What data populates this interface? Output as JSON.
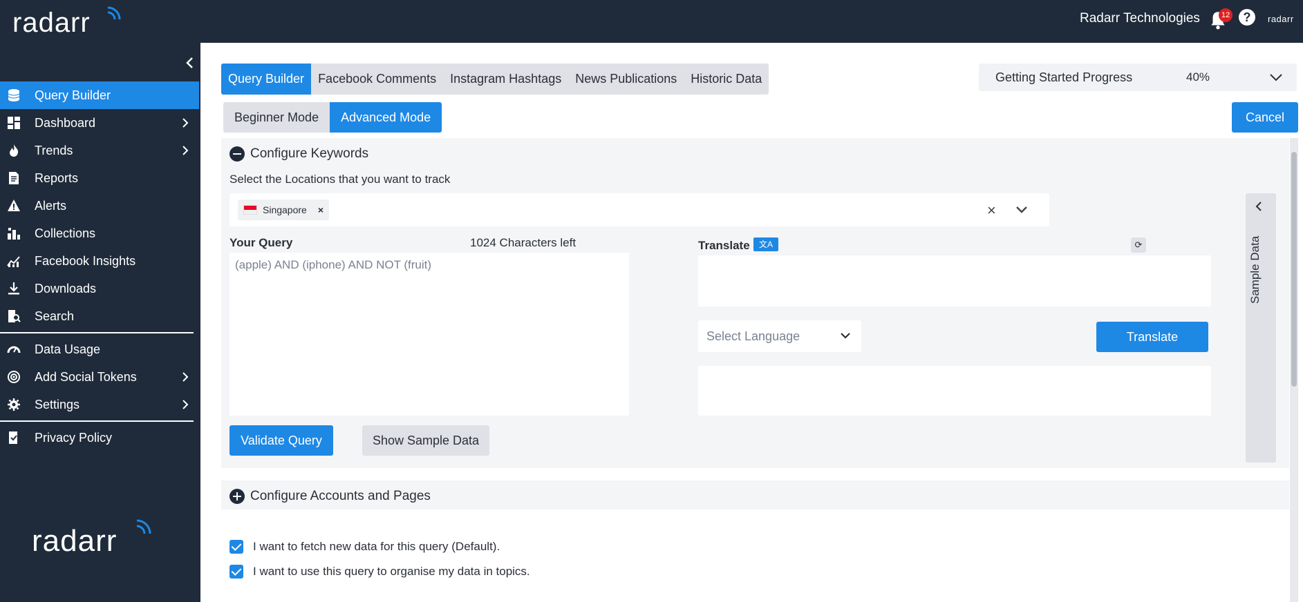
{
  "topbar": {
    "org_name": "Radarr Technologies",
    "notification_count": "12",
    "help_glyph": "?",
    "mini_logo": "radarr",
    "logo_text": "radarr"
  },
  "sidebar": {
    "collapse_glyph": "‹",
    "items": [
      {
        "label": "Query Builder",
        "icon": "database-icon",
        "has_submenu": false,
        "active": true
      },
      {
        "label": "Dashboard",
        "icon": "dashboard-icon",
        "has_submenu": true
      },
      {
        "label": "Trends",
        "icon": "flame-icon",
        "has_submenu": true
      },
      {
        "label": "Reports",
        "icon": "document-icon",
        "has_submenu": false
      },
      {
        "label": "Alerts",
        "icon": "warning-icon",
        "has_submenu": false
      },
      {
        "label": "Collections",
        "icon": "collections-icon",
        "has_submenu": false
      },
      {
        "label": "Facebook Insights",
        "icon": "chart-line-icon",
        "has_submenu": false
      },
      {
        "label": "Downloads",
        "icon": "download-icon",
        "has_submenu": false
      },
      {
        "label": "Search",
        "icon": "search-doc-icon",
        "has_submenu": false
      },
      {
        "label": "Data Usage",
        "icon": "gauge-icon",
        "has_submenu": false
      },
      {
        "label": "Add Social Tokens",
        "icon": "target-icon",
        "has_submenu": true
      },
      {
        "label": "Settings",
        "icon": "gear-icon",
        "has_submenu": true
      },
      {
        "label": "Privacy Policy",
        "icon": "shield-doc-icon",
        "has_submenu": false
      }
    ],
    "footer_logo": "radarr"
  },
  "tabs": [
    "Query Builder",
    "Facebook Comments",
    "Instagram Hashtags",
    "News Publications",
    "Historic Data"
  ],
  "progress": {
    "label": "Getting Started Progress",
    "percent": "40%"
  },
  "modes": {
    "beginner": "Beginner Mode",
    "advanced": "Advanced Mode"
  },
  "cancel_label": "Cancel",
  "keywords": {
    "title": "Configure Keywords",
    "locations_label": "Select the Locations that you want to track",
    "locations": [
      {
        "name": "Singapore",
        "flag": "SG"
      }
    ],
    "query_label": "Your Query",
    "chars_left": "1024 Characters left",
    "query_text": "(apple) AND (iphone) AND NOT (fruit)",
    "translate_label": "Translate",
    "translate_icon_text": "文A",
    "language_placeholder": "Select Language",
    "translate_button": "Translate",
    "validate_button": "Validate Query",
    "sample_button": "Show Sample Data",
    "sample_panel_label": "Sample Data"
  },
  "accounts": {
    "title": "Configure Accounts and Pages"
  },
  "options": [
    {
      "label": "I want to fetch new data for this query (Default).",
      "checked": true
    },
    {
      "label": "I want to use this query to organise my data in topics.",
      "checked": true
    }
  ],
  "colors": {
    "accent": "#1e88e5",
    "sidebar": "#1f2b3a",
    "badge": "#e02020"
  }
}
